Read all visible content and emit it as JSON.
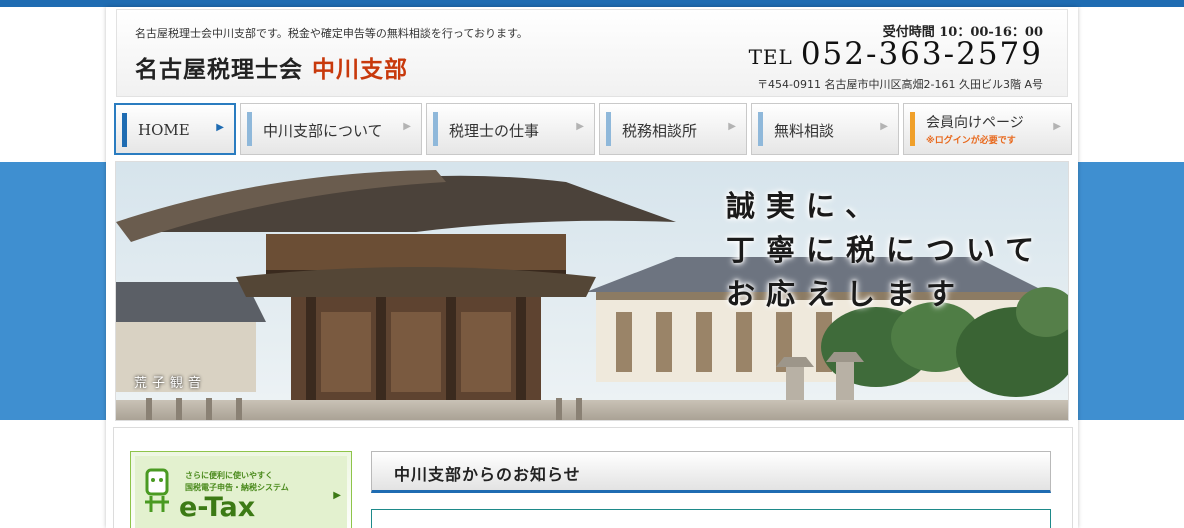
{
  "header": {
    "tagline": "名古屋税理士会中川支部です。税金や確定申告等の無料相談を行っております。",
    "site_name_main": "名古屋税理士会",
    "site_name_accent": "中川支部",
    "hours": "受付時間 10：00-16：00",
    "tel_label": "TEL",
    "tel_number": "052-363-2579",
    "address": "〒454-0911 名古屋市中川区高畑2-161 久田ビル3階 A号"
  },
  "nav": {
    "items": [
      {
        "label": "HOME",
        "sublabel": ""
      },
      {
        "label": "中川支部について",
        "sublabel": ""
      },
      {
        "label": "税理士の仕事",
        "sublabel": ""
      },
      {
        "label": "税務相談所",
        "sublabel": ""
      },
      {
        "label": "無料相談",
        "sublabel": ""
      },
      {
        "label": "会員向けページ",
        "sublabel": "※ログインが必要です"
      }
    ],
    "arrow_glyph": "▶"
  },
  "hero": {
    "slogan": [
      "誠実に、",
      "丁寧に税について",
      "お応えします"
    ],
    "caption": "荒子観音"
  },
  "sidebar": {
    "etax": {
      "line1": "さらに便利に使いやすく",
      "line2": "国税電子申告・納税システム",
      "title": "e-Tax"
    }
  },
  "news": {
    "title": "中川支部からのお知らせ"
  },
  "colors": {
    "brand_blue": "#1f6cb2",
    "band_blue": "#3f8fd0",
    "accent_red": "#c8390c",
    "member_orange": "#f0a02a",
    "etax_green": "#3c7a15"
  }
}
